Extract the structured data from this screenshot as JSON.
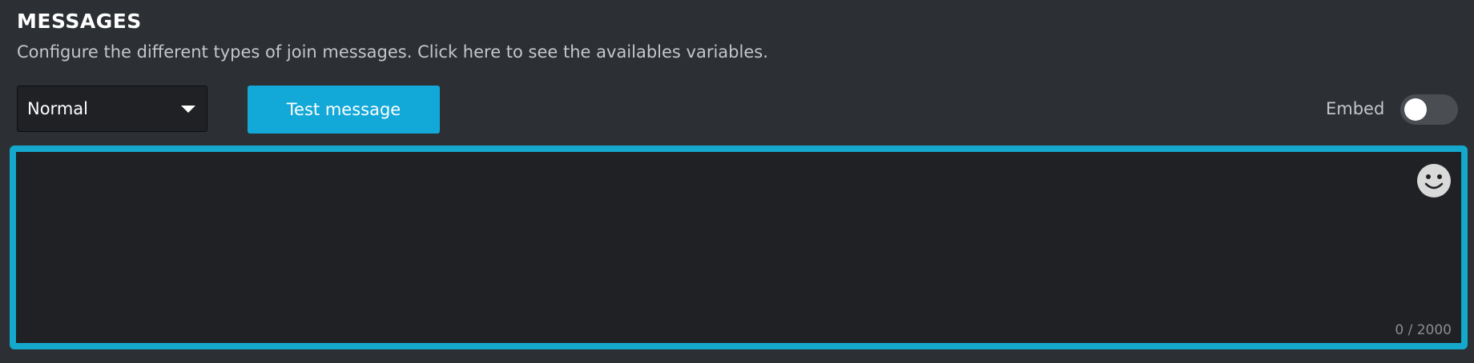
{
  "section": {
    "title": "MESSAGES",
    "description_prefix": "Configure the different types of join messages. ",
    "description_link": "Click here to see the availables variables."
  },
  "message_type_select": {
    "value": "Normal",
    "icon": "chevron-down-icon"
  },
  "test_button": {
    "label": "Test message",
    "color": "#12a8d8"
  },
  "embed_toggle": {
    "label": "Embed",
    "enabled": false
  },
  "editor": {
    "value": "",
    "border_color": "#13a8cc",
    "emoji_icon": "smiley-face-icon",
    "counter": "0 / 2000"
  }
}
